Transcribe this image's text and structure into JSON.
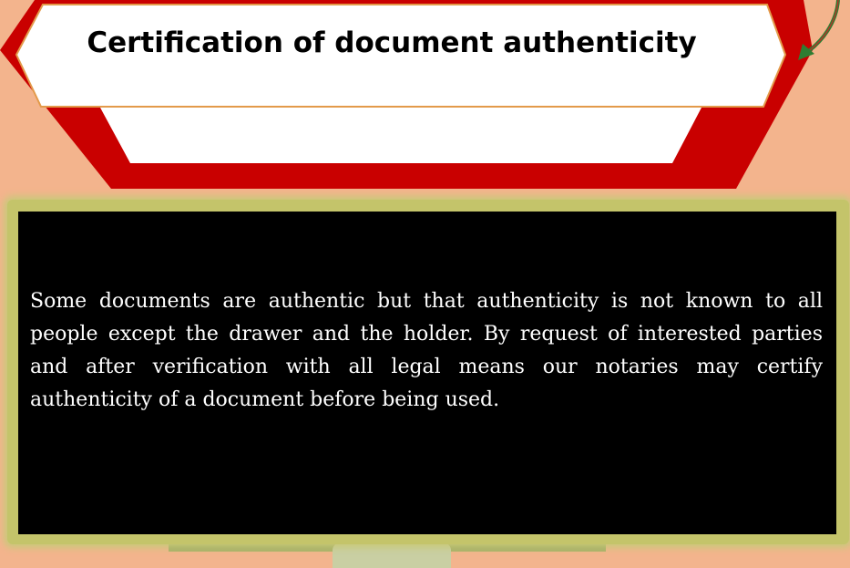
{
  "header": {
    "title": "Certification of document authenticity"
  },
  "content": {
    "paragraph": "Some documents are authentic but that authenticity is not known to all people except the drawer and the holder. By request of interested parties and after verification with all legal means our notaries may certify authenticity of a document before being used."
  },
  "colors": {
    "page_background": "#f3b48d",
    "banner_red": "#c90000",
    "panel_background": "#000000",
    "panel_frame": "#c4c46a",
    "arrow_green": "#2e7d32"
  }
}
